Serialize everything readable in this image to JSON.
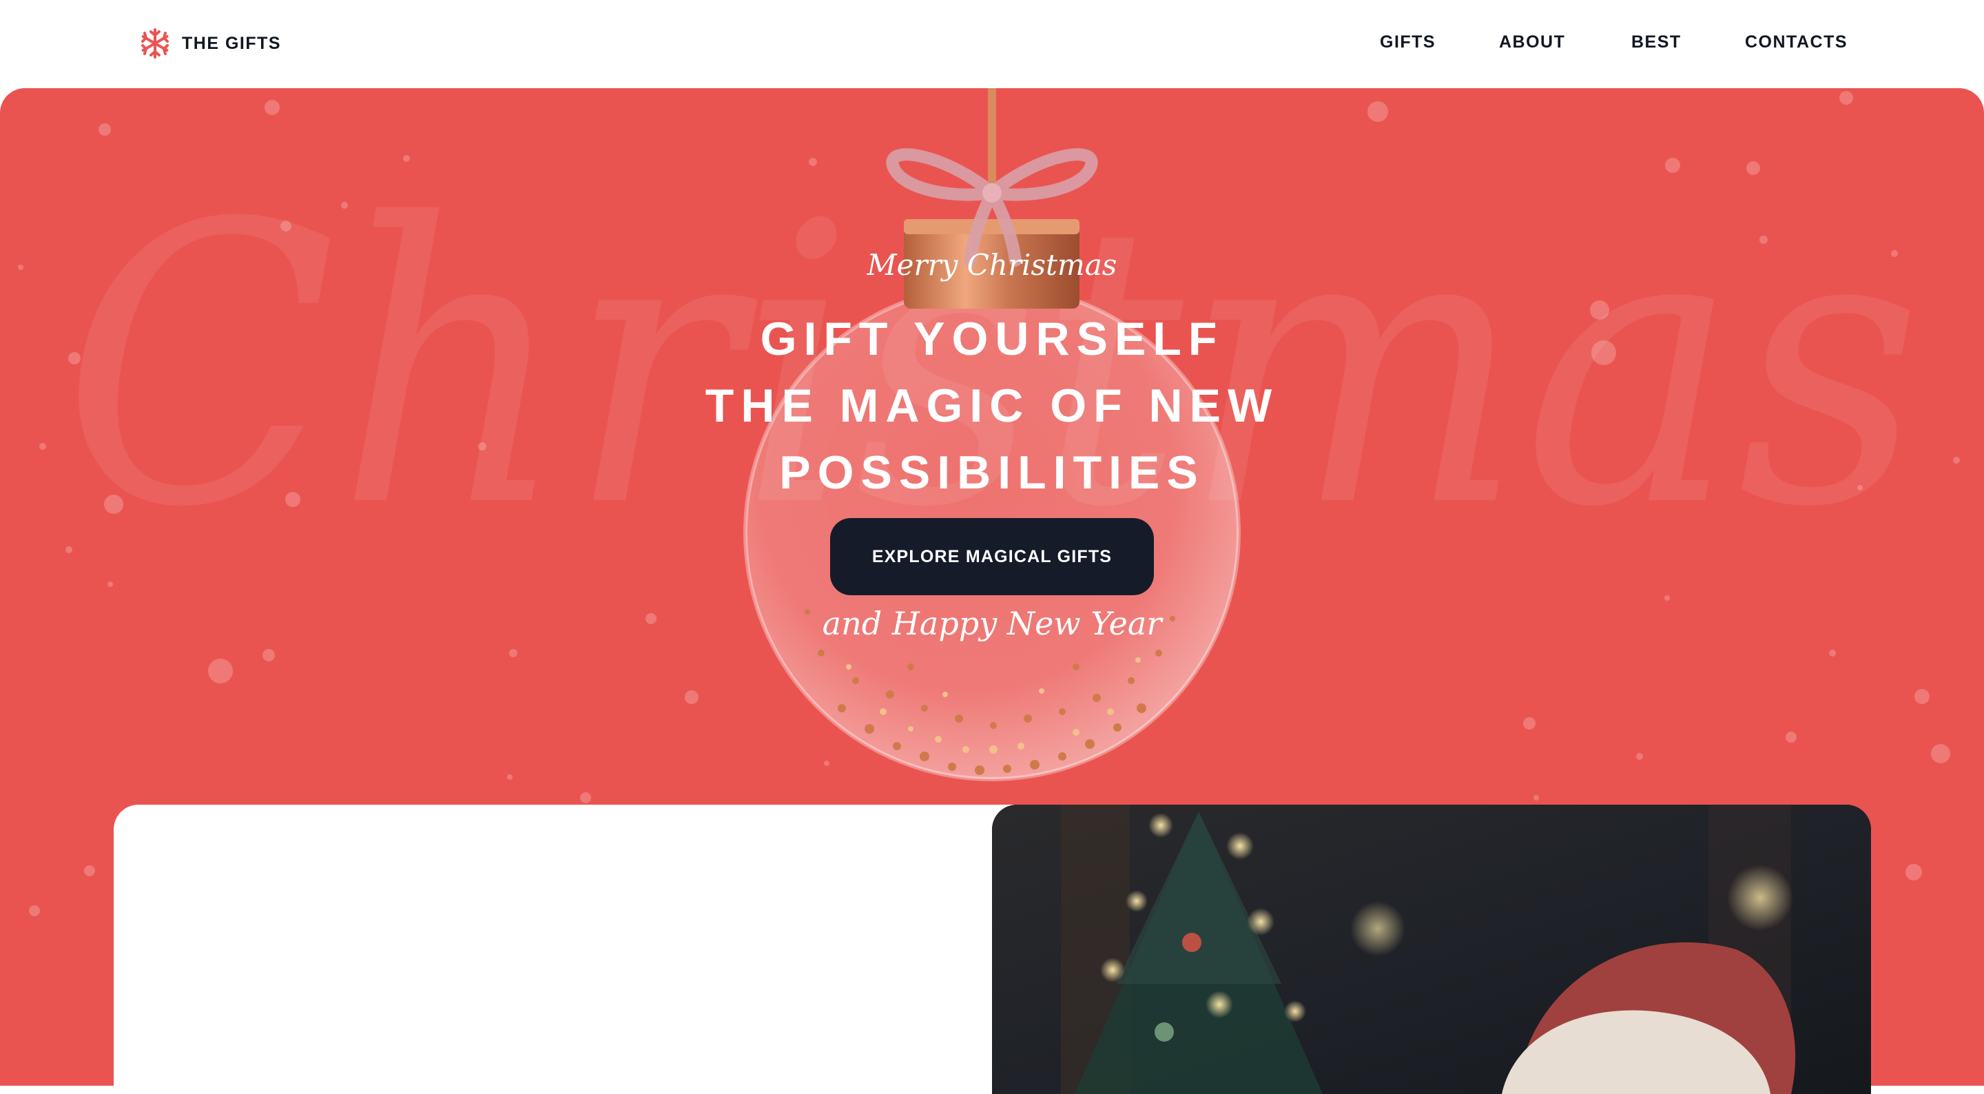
{
  "brand": {
    "name": "THE GIFTS",
    "logo_icon": "snowflake-icon",
    "accent_color": "#ea5450"
  },
  "nav": {
    "items": [
      {
        "label": "GIFTS"
      },
      {
        "label": "ABOUT"
      },
      {
        "label": "BEST"
      },
      {
        "label": "CONTACTS"
      }
    ]
  },
  "hero": {
    "background_color": "#ea5450",
    "watermark_text": "Christmas",
    "script_top": "Merry Christmas",
    "headline_lines": [
      "GIFT YOURSELF",
      "THE MAGIC OF NEW",
      "POSSIBILITIES"
    ],
    "cta_label": "EXPLORE MAGICAL GIFTS",
    "cta_color": "#161b2a",
    "script_bottom": "and Happy New Year"
  },
  "promo": {
    "photo": "santa-christmas-tree-photo"
  }
}
